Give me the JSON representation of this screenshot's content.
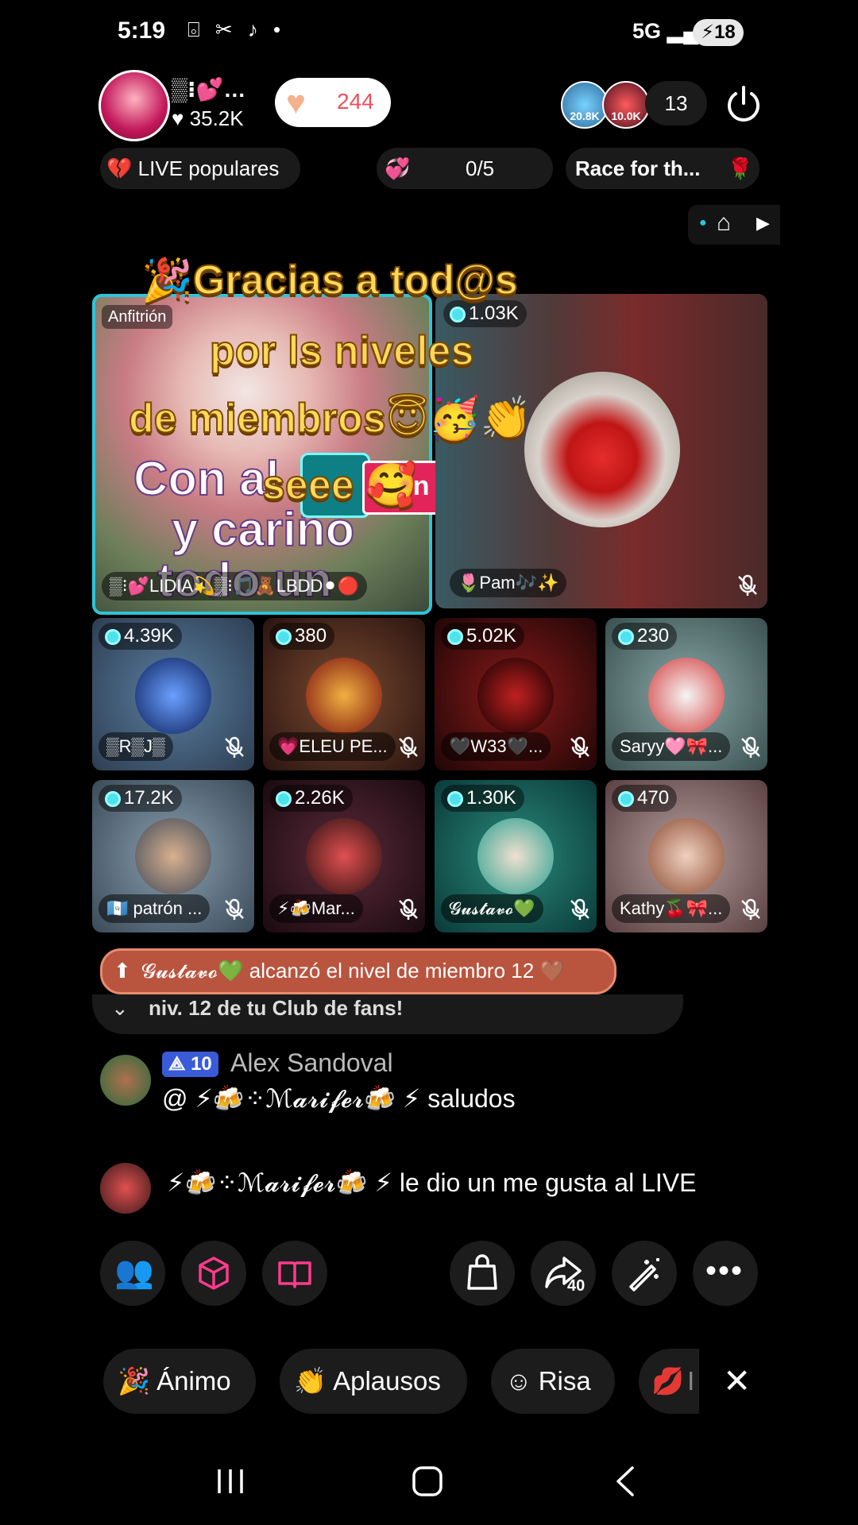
{
  "status_bar": {
    "time": "5:19",
    "icons": "⌻ ✂ ♪ •",
    "network": "5G",
    "battery": "18"
  },
  "host": {
    "name": "▒⁝💕…",
    "likes": "♥ 35.2K",
    "like_count": "244"
  },
  "viewers": {
    "v1_label": "20.8K",
    "v2_label": "10.0K",
    "count": "13"
  },
  "chips": {
    "live_label": "LIVE populares",
    "goal_progress": "0/5",
    "race_label": "Race for th..."
  },
  "overlay_text": [
    "🎉Gracias a tod@s",
    "por ls niveles",
    "de miembros😇🥳👏",
    "seee 🥰"
  ],
  "host_tile": {
    "role_label": "Anfitrión",
    "sign_lines": [
      "Con al",
      "y cariño",
      "todo un"
    ],
    "sticker": "in fuga",
    "name_chips": "▒⁝💕LIDIA💫▒⁝🎵🧸LBDD⚫🔴"
  },
  "guest_main": {
    "coins": "1.03K",
    "name": "🌷Pam🎶✨"
  },
  "guests": [
    {
      "coins": "4.39K",
      "name": "▒R▒J▒"
    },
    {
      "coins": "380",
      "name": "💗ELEU PE..."
    },
    {
      "coins": "5.02K",
      "name": "🖤W33🖤..."
    },
    {
      "coins": "230",
      "name": "Saryy🩷🎀..."
    },
    {
      "coins": "17.2K",
      "name": "🇬🇹 patrón ..."
    },
    {
      "coins": "2.26K",
      "name": "⚡🍻Mar..."
    },
    {
      "coins": "1.30K",
      "name": "𝓖𝓾𝓼𝓽𝓪𝓿𝓸💚"
    },
    {
      "coins": "470",
      "name": "Kathy🍒🎀..."
    }
  ],
  "notice": {
    "text": "𝓖𝓾𝓼𝓽𝓪𝓿𝓸💚 alcanzó el nivel de miembro 12 🤎",
    "fan_club": "niv. 12 de tu Club de fans!"
  },
  "comments": [
    {
      "level": "10",
      "author": "Alex Sandoval",
      "text": "@ ⚡🍻⁘ℳ𝓪𝓻𝓲𝓯𝓮𝓻🍻 ⚡ saludos"
    },
    {
      "text": "⚡🍻⁘ℳ𝓪𝓻𝓲𝓯𝓮𝓻🍻 ⚡ le dio un me gusta al LIVE"
    }
  ],
  "actions": {
    "share_count": "40"
  },
  "reactions": [
    {
      "label": "Ánimo"
    },
    {
      "label": "Aplausos"
    },
    {
      "label": "Risa"
    },
    {
      "label": "I"
    }
  ],
  "colors": {
    "host_border": "#2ec4d8",
    "accent_pink": "#ff3b8d",
    "overlay_yellow": "#ffd95a",
    "notice_bg": "#b9543f"
  }
}
